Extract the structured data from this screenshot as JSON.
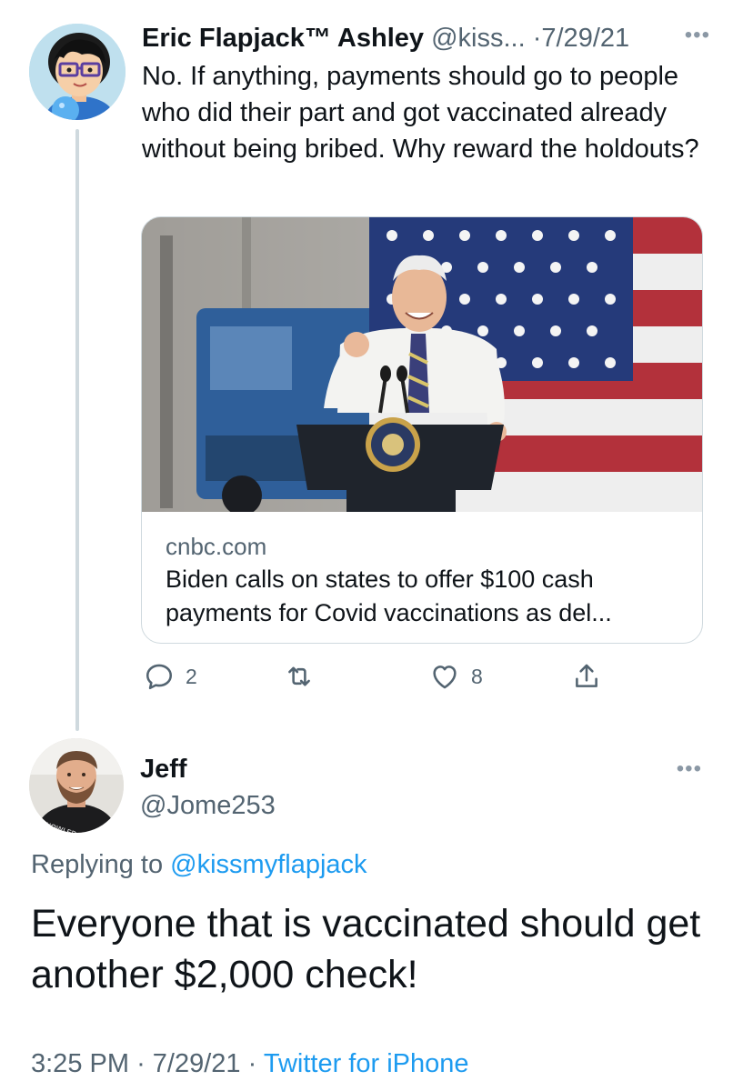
{
  "tweet1": {
    "name": "Eric Flapjack™ Ashley",
    "handle": "@kiss...",
    "separator": "·",
    "date": "7/29/21",
    "more_icon": "ellipsis-icon",
    "text": "No.  If anything, payments should go to people who did their part and got vaccinated already without being bribed.   Why reward the holdouts?",
    "avatar": "cartoon-avatar-with-glasses",
    "card": {
      "image": "president-at-podium-with-flag-photo",
      "domain": "cnbc.com",
      "title": "Biden calls on states to offer $100 cash payments for Covid vaccinations as del..."
    },
    "actions": {
      "reply": {
        "icon": "reply-icon",
        "count": "2"
      },
      "retweet": {
        "icon": "retweet-icon",
        "count": ""
      },
      "like": {
        "icon": "heart-icon",
        "count": "8"
      },
      "share": {
        "icon": "share-icon",
        "count": ""
      }
    }
  },
  "tweet2": {
    "name": "Jeff",
    "handle": "@Jome253",
    "more_icon": "ellipsis-icon",
    "avatar": "bearded-man-photo",
    "avatar_shirt_text": "KNOWLED",
    "replying_prefix": "Replying to",
    "replying_mention": "@kissmyflapjack",
    "text": "Everyone that is vaccinated should get another $2,000 check!",
    "time": "3:25 PM",
    "date": "7/29/21",
    "source": "Twitter for iPhone"
  },
  "colors": {
    "text": "#0f1419",
    "secondary": "#536471",
    "link": "#1d9bf0",
    "border": "#cfd9de"
  }
}
